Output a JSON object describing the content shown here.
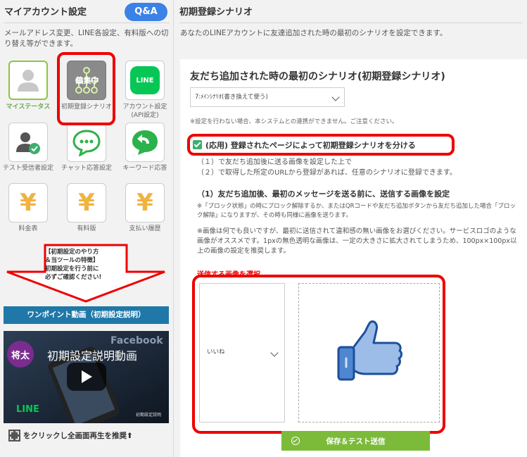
{
  "left": {
    "title": "マイアカウント設定",
    "qa_label": "Q&A",
    "description": "メールアドレス変更、LINE各設定、有料版への切り替え等ができます。",
    "tiles": [
      {
        "label": "マイステータス",
        "icon": "person-icon"
      },
      {
        "label": "初期登録シナリオ",
        "icon": "scenario-icon",
        "overlay": "編集中"
      },
      {
        "label": "アカウント設定(API設定)",
        "icon": "line-icon",
        "icon_text": "LINE"
      },
      {
        "label": "テスト受信者設定",
        "icon": "test-user-icon"
      },
      {
        "label": "チャット応答設定",
        "icon": "chat-icon"
      },
      {
        "label": "キーワード応答",
        "icon": "keyword-reply-icon"
      },
      {
        "label": "料金表",
        "icon": "yen-icon",
        "icon_text": "¥"
      },
      {
        "label": "有料版",
        "icon": "yen-icon",
        "icon_text": "¥"
      },
      {
        "label": "支払い履歴",
        "icon": "yen-icon",
        "icon_text": "¥"
      }
    ],
    "notice_lines": [
      "【初期設定のやり方",
      "＆当ツールの特徴】",
      "初期設定を行う前に",
      "必ずご確認ください!"
    ],
    "onepoint_button": "ワンポイント動画（初期設定説明）",
    "video": {
      "avatar_text": "将太",
      "title": "初期設定説明動画",
      "brand": "Facebook",
      "footer": "LINE",
      "caption": "初期設定説明"
    },
    "fullscreen_text": "をクリックし全画面再生を推奨",
    "arrow_glyph": "⬆"
  },
  "right": {
    "title": "初期登録シナリオ",
    "description": "あなたのLINEアカウントに友達追加された時の最初のシナリオを設定できます。",
    "card": {
      "title": "友だち追加された時の最初のシナリオ(初期登録シナリオ)",
      "scenario_select": "7:ﾒｲﾝｼﾅﾘｵ(書き換えて使う)",
      "note1": "※設定を行わない場合、本システムとの連携ができません。ご注意ください。",
      "checkbox_label": "(応用) 登録されたページによって初期登録シナリオを分ける",
      "checkbox_checked": true,
      "step1": "（１）で友だち追加後に送る画像を設定した上で",
      "step2": "（２）で取得した所定のURLから登録があれば、任意のシナリオに登録できます。",
      "sub_title": "（1）友だち追加後、最初のメッセージを送る前に、送信する画像を設定",
      "note2": "※「ブロック状態」の時にブロック解除するか、またはQRコードや友だち追加ボタンから友だち追加した場合「ブロック解除」になりますが、その時も同様に画像を送ります。",
      "note3": "※画像は何でも良いですが、最初に送信されて違和感の無い画像をお選びください。サービスロゴのような画像がオススメです。1pxの無色透明な画像は、一定の大きさに拡大されてしまうため、100px×100px以上の画像の設定を推奨します。",
      "image_label": "送信する画像を選択",
      "image_select": "いいね",
      "save_button": "保存＆テスト送信"
    }
  },
  "colors": {
    "accent_red": "#e00000",
    "line_green": "#06c755",
    "save_green": "#7cbb3a",
    "onepoint_blue": "#1f78a8",
    "qa_blue": "#3b82e6"
  }
}
